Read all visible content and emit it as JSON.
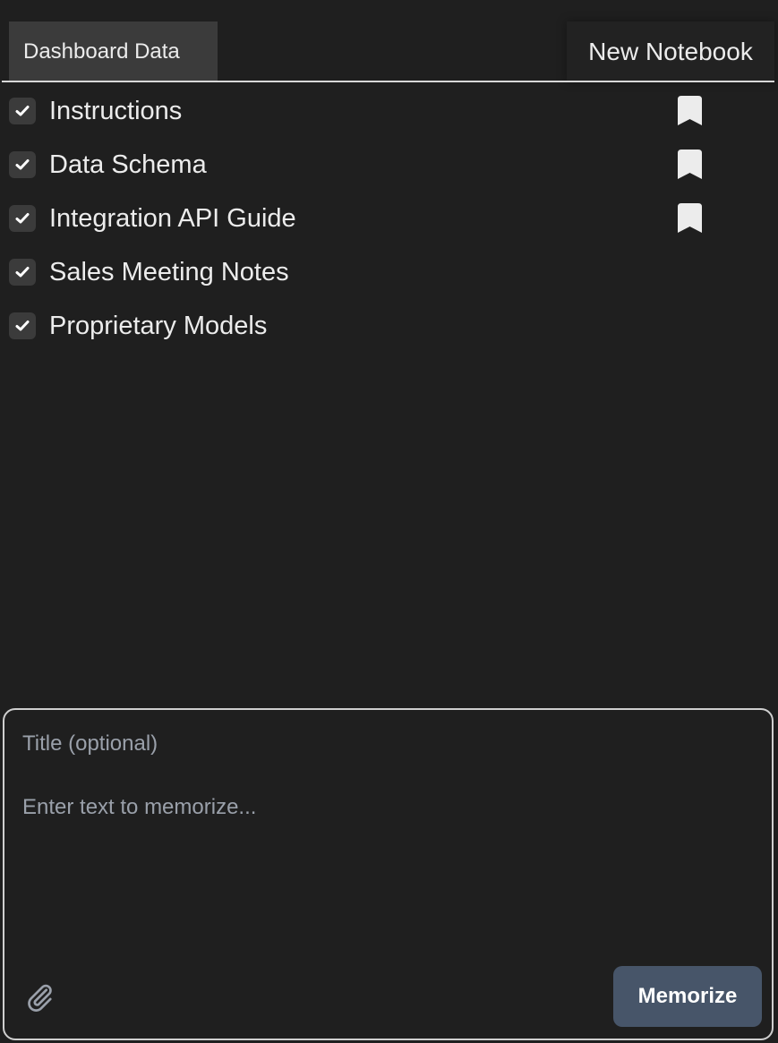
{
  "tabs": {
    "active_label": "Dashboard Data",
    "new_label": "New Notebook"
  },
  "documents": [
    {
      "label": "Instructions",
      "checked": true,
      "bookmarked": true
    },
    {
      "label": "Data Schema",
      "checked": true,
      "bookmarked": true
    },
    {
      "label": "Integration API Guide",
      "checked": true,
      "bookmarked": true
    },
    {
      "label": "Sales Meeting Notes",
      "checked": true,
      "bookmarked": false
    },
    {
      "label": "Proprietary Models",
      "checked": true,
      "bookmarked": false
    }
  ],
  "composer": {
    "title_value": "",
    "title_placeholder": "Title (optional)",
    "body_value": "",
    "body_placeholder": "Enter text to memorize...",
    "attach_icon": "paperclip-icon",
    "submit_label": "Memorize"
  },
  "icons": {
    "checkbox": "checkmark-icon",
    "bookmark": "bookmark-icon"
  },
  "colors": {
    "background": "#1f1f1f",
    "active_tab": "#3b3b3b",
    "button": "#475569",
    "text": "#ececec",
    "placeholder": "#9aa0aa"
  }
}
